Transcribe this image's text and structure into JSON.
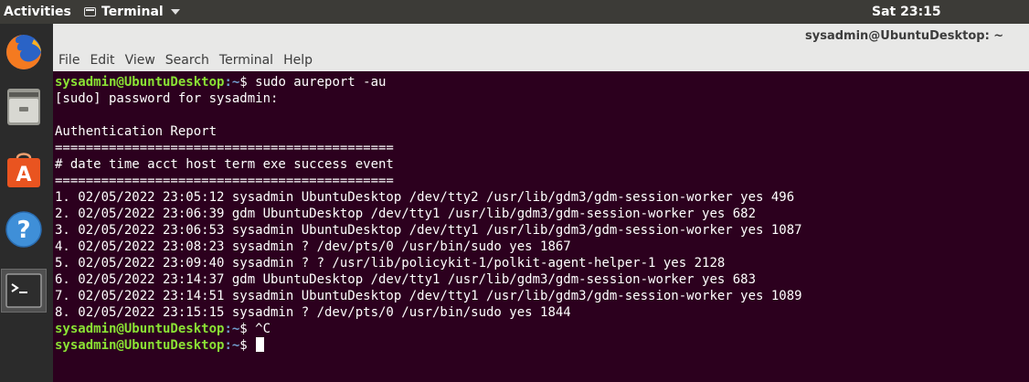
{
  "topbar": {
    "activities": "Activities",
    "app_name": "Terminal",
    "clock": "Sat 23:15"
  },
  "dock": {
    "items": [
      "firefox-icon",
      "files-icon",
      "software-center-icon",
      "help-icon",
      "terminal-icon"
    ]
  },
  "window": {
    "title": "sysadmin@UbuntuDesktop: ~",
    "menu": [
      "File",
      "Edit",
      "View",
      "Search",
      "Terminal",
      "Help"
    ]
  },
  "terminal": {
    "prompt_user": "sysadmin@UbuntuDesktop",
    "prompt_path": ":~",
    "prompt_sign": "$ ",
    "lines": [
      {
        "kind": "prompt",
        "cmd": "sudo aureport -au"
      },
      {
        "kind": "out",
        "text": "[sudo] password for sysadmin:"
      },
      {
        "kind": "out",
        "text": ""
      },
      {
        "kind": "out",
        "text": "Authentication Report"
      },
      {
        "kind": "out",
        "text": "============================================"
      },
      {
        "kind": "out",
        "text": "# date time acct host term exe success event"
      },
      {
        "kind": "out",
        "text": "============================================"
      },
      {
        "kind": "out",
        "text": "1. 02/05/2022 23:05:12 sysadmin UbuntuDesktop /dev/tty2 /usr/lib/gdm3/gdm-session-worker yes 496"
      },
      {
        "kind": "out",
        "text": "2. 02/05/2022 23:06:39 gdm UbuntuDesktop /dev/tty1 /usr/lib/gdm3/gdm-session-worker yes 682"
      },
      {
        "kind": "out",
        "text": "3. 02/05/2022 23:06:53 sysadmin UbuntuDesktop /dev/tty1 /usr/lib/gdm3/gdm-session-worker yes 1087"
      },
      {
        "kind": "out",
        "text": "4. 02/05/2022 23:08:23 sysadmin ? /dev/pts/0 /usr/bin/sudo yes 1867"
      },
      {
        "kind": "out",
        "text": "5. 02/05/2022 23:09:40 sysadmin ? ? /usr/lib/policykit-1/polkit-agent-helper-1 yes 2128"
      },
      {
        "kind": "out",
        "text": "6. 02/05/2022 23:14:37 gdm UbuntuDesktop /dev/tty1 /usr/lib/gdm3/gdm-session-worker yes 683"
      },
      {
        "kind": "out",
        "text": "7. 02/05/2022 23:14:51 sysadmin UbuntuDesktop /dev/tty1 /usr/lib/gdm3/gdm-session-worker yes 1089"
      },
      {
        "kind": "out",
        "text": "8. 02/05/2022 23:15:15 sysadmin ? /dev/pts/0 /usr/bin/sudo yes 1844"
      },
      {
        "kind": "prompt",
        "cmd": "^C"
      },
      {
        "kind": "prompt",
        "cmd": "",
        "cursor": true
      }
    ]
  },
  "colors": {
    "terminal_bg": "#2c001e",
    "prompt_user": "#8ae234",
    "prompt_path": "#729fcf",
    "topbar_bg": "#3c3b37",
    "dock_bg": "#2b2b2b"
  }
}
